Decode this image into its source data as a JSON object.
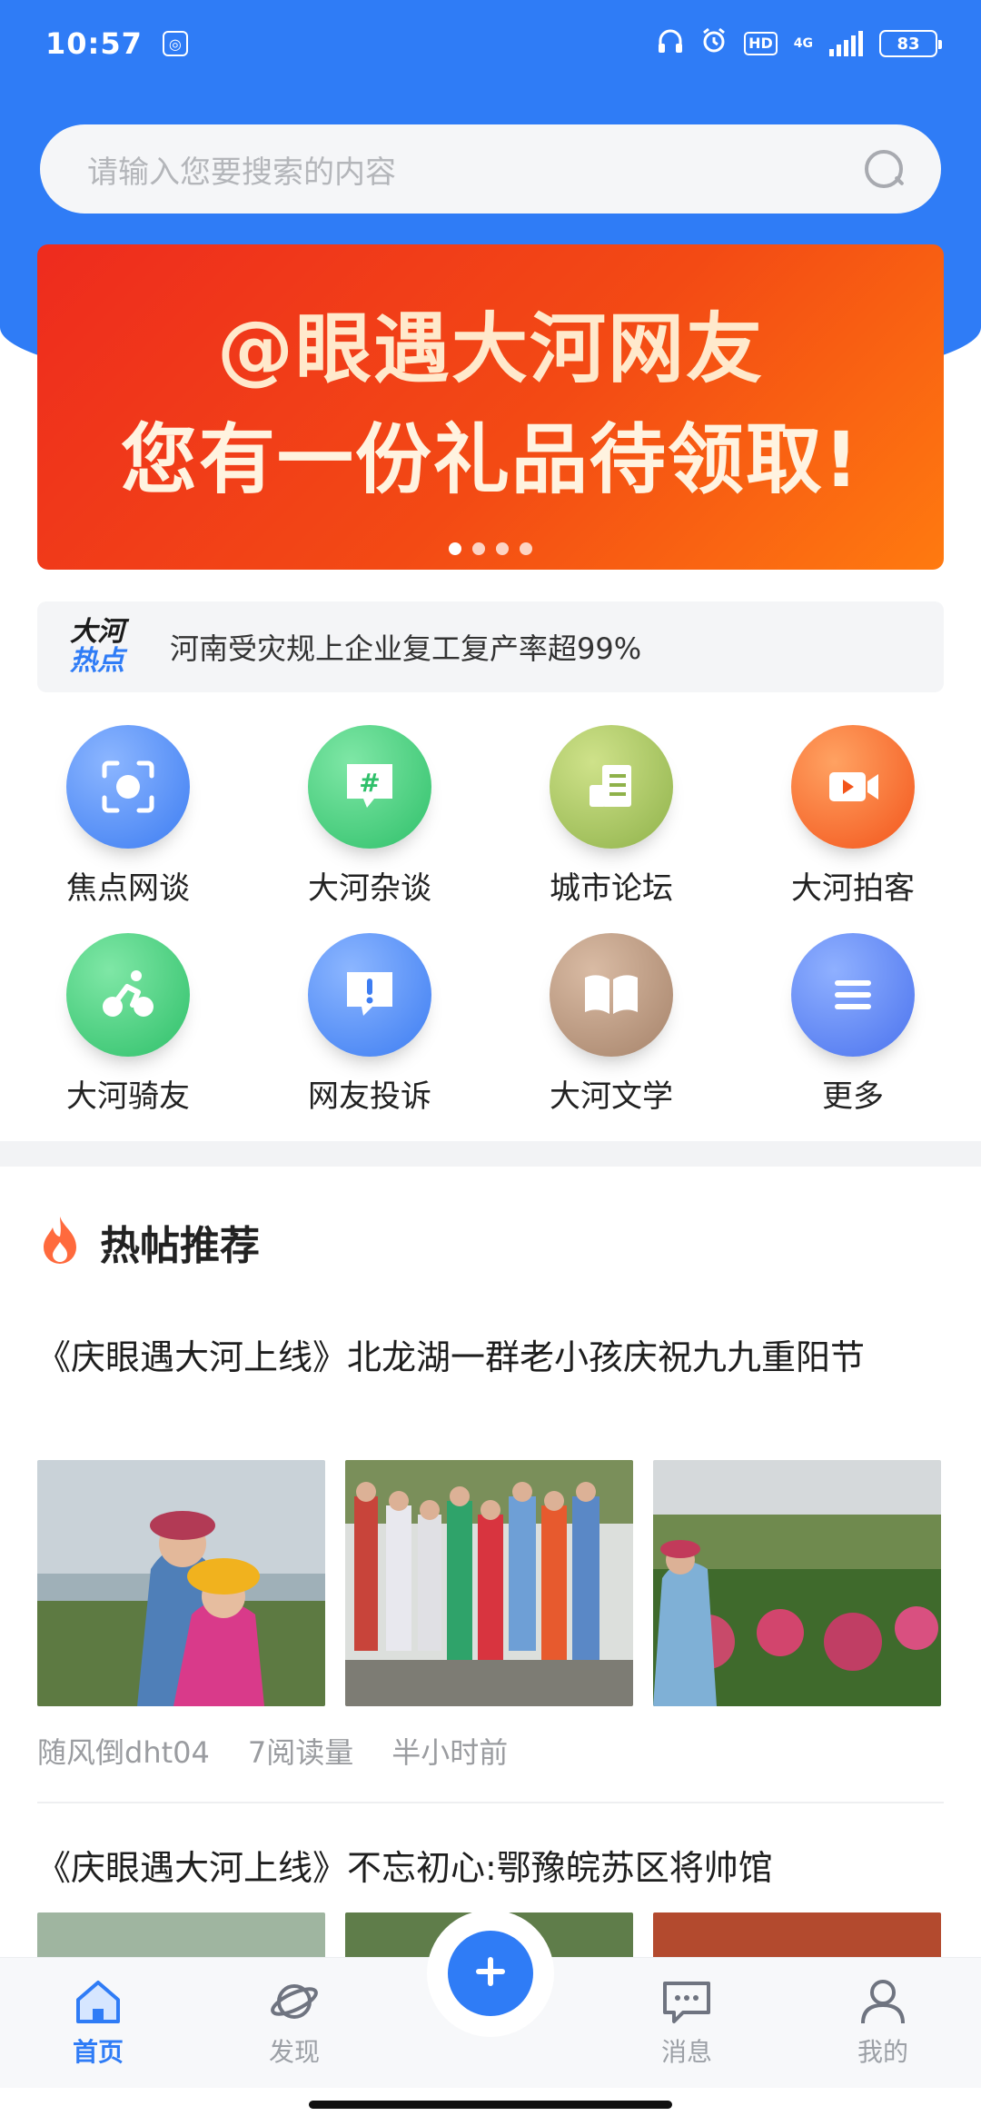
{
  "status_bar": {
    "time": "10:57",
    "hd": "HD",
    "network": "4G",
    "battery": "83"
  },
  "search": {
    "placeholder": "请输入您要搜索的内容"
  },
  "banner": {
    "line1": "@眼遇大河网友",
    "line2": "您有一份礼品待领取!",
    "dot_count": 4,
    "active_dot": 1
  },
  "hot_news": {
    "logo_line1": "大河",
    "logo_line2": "热点",
    "text": "河南受灾规上企业复工复产率超99%"
  },
  "grid": [
    {
      "label": "焦点网谈",
      "icon": "focus-icon"
    },
    {
      "label": "大河杂谈",
      "icon": "hashtag-chat-icon"
    },
    {
      "label": "城市论坛",
      "icon": "document-icon"
    },
    {
      "label": "大河拍客",
      "icon": "video-icon"
    },
    {
      "label": "大河骑友",
      "icon": "cyclist-icon"
    },
    {
      "label": "网友投诉",
      "icon": "exclamation-chat-icon"
    },
    {
      "label": "大河文学",
      "icon": "book-icon"
    },
    {
      "label": "更多",
      "icon": "menu-icon"
    }
  ],
  "section": {
    "title": "热帖推荐"
  },
  "posts": [
    {
      "title": "《庆眼遇大河上线》北龙湖一群老小孩庆祝九九重阳节",
      "author": "随风倒dht04",
      "reads": "7阅读量",
      "time": "半小时前"
    },
    {
      "title": "《庆眼遇大河上线》不忘初心:鄂豫皖苏区将帅馆"
    }
  ],
  "tabbar": {
    "items": [
      {
        "label": "首页",
        "icon": "home-icon",
        "active": true
      },
      {
        "label": "发现",
        "icon": "planet-icon",
        "active": false
      },
      {
        "label": "消息",
        "icon": "message-icon",
        "active": false
      },
      {
        "label": "我的",
        "icon": "user-icon",
        "active": false
      }
    ]
  },
  "colors": {
    "primary": "#2f7cf6",
    "banner_red": "#ee2b1e",
    "banner_orange": "#ff7a10"
  }
}
